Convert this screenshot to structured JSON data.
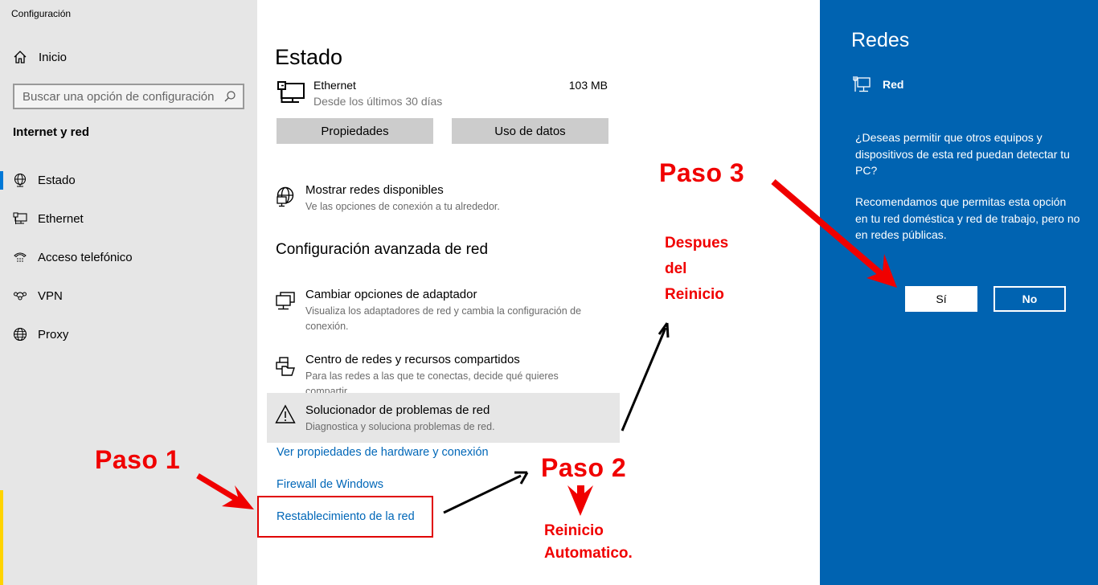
{
  "sidebar": {
    "app_title": "Configuración",
    "home_label": "Inicio",
    "search_placeholder": "Buscar una opción de configuración",
    "section_title": "Internet y red",
    "items": [
      {
        "label": "Estado",
        "icon": "status-globe-icon",
        "active": true
      },
      {
        "label": "Ethernet",
        "icon": "ethernet-icon",
        "active": false
      },
      {
        "label": "Acceso telefónico",
        "icon": "dialup-phone-icon",
        "active": false
      },
      {
        "label": "VPN",
        "icon": "vpn-icon",
        "active": false
      },
      {
        "label": "Proxy",
        "icon": "globe-icon",
        "active": false
      }
    ]
  },
  "main": {
    "title": "Estado",
    "connection": {
      "name": "Ethernet",
      "subtitle": "Desde los últimos 30 días",
      "usage": "103 MB"
    },
    "buttons": {
      "properties": "Propiedades",
      "data_usage": "Uso de datos"
    },
    "show_networks": {
      "title": "Mostrar redes disponibles",
      "desc": "Ve las opciones de conexión a tu alrededor."
    },
    "advanced_heading": "Configuración avanzada de red",
    "options": [
      {
        "title": "Cambiar opciones de adaptador",
        "desc": "Visualiza los adaptadores de red y cambia la configuración de conexión."
      },
      {
        "title": "Centro de redes y recursos compartidos",
        "desc": "Para las redes a las que te conectas, decide qué quieres compartir."
      },
      {
        "title": "Solucionador de problemas de red",
        "desc": "Diagnostica y soluciona problemas de red."
      }
    ],
    "links": {
      "hardware": "Ver propiedades de hardware y conexión",
      "firewall": "Firewall de Windows",
      "reset": "Restablecimiento de la red"
    }
  },
  "annotations": {
    "step1": "Paso 1",
    "step2": "Paso 2",
    "step2_note_line1": "Reinicio",
    "step2_note_line2": "Automatico.",
    "step3": "Paso 3",
    "after_line1": "Despues",
    "after_line2": "del",
    "after_line3": "Reinicio",
    "annotation_color": "#f00000"
  },
  "flyout": {
    "title": "Redes",
    "network_name": "Red",
    "question": "¿Deseas permitir que otros equipos y dispositivos de esta red puedan detectar tu PC?",
    "recommendation": "Recomendamos que permitas esta opción en tu red doméstica y red de trabajo, pero no en redes públicas.",
    "yes_label": "Sí",
    "no_label": "No",
    "background_color": "#0063b1"
  },
  "colors": {
    "accent": "#0078d7",
    "link": "#0067b8",
    "sidebar_bg": "#e6e6e6"
  }
}
